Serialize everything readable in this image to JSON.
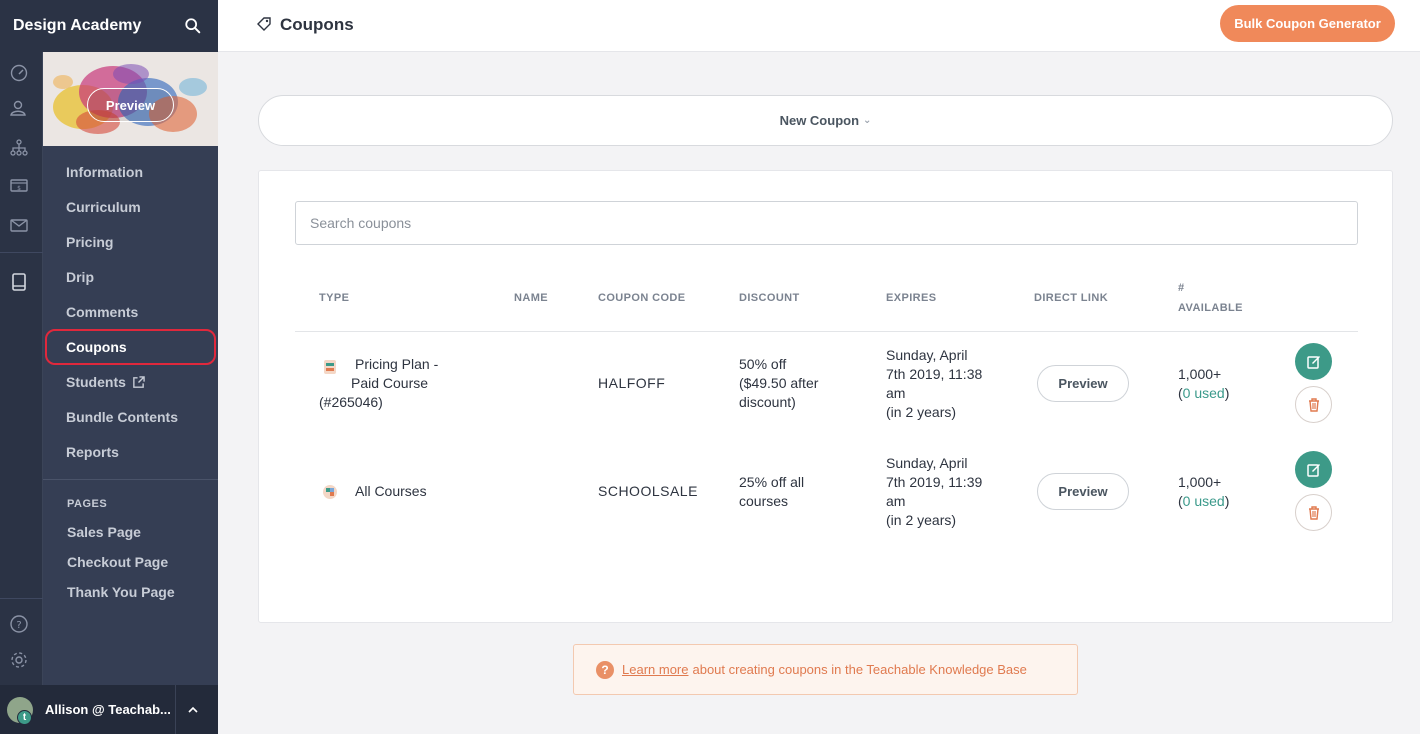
{
  "app": {
    "brand": "Design Academy",
    "page_title": "Coupons",
    "bulk_button": "Bulk Coupon Generator"
  },
  "thumbnail": {
    "preview_label": "Preview"
  },
  "subnav": {
    "items": [
      {
        "label": "Information"
      },
      {
        "label": "Curriculum"
      },
      {
        "label": "Pricing"
      },
      {
        "label": "Drip"
      },
      {
        "label": "Comments"
      },
      {
        "label": "Coupons",
        "active": true
      },
      {
        "label": "Students",
        "external": true
      },
      {
        "label": "Bundle Contents"
      },
      {
        "label": "Reports"
      }
    ],
    "pages_heading": "PAGES",
    "pages": [
      {
        "label": "Sales Page"
      },
      {
        "label": "Checkout Page"
      },
      {
        "label": "Thank You Page"
      }
    ]
  },
  "user": {
    "name": "Allison @ Teachab...",
    "badge": "t"
  },
  "new_coupon": {
    "label": "New Coupon"
  },
  "search": {
    "placeholder": "Search coupons",
    "value": ""
  },
  "table": {
    "headers": {
      "type": "TYPE",
      "name": "NAME",
      "code": "COUPON CODE",
      "discount": "DISCOUNT",
      "expires": "EXPIRES",
      "link": "DIRECT LINK",
      "available_1": "#",
      "available_2": "AVAILABLE"
    },
    "rows": [
      {
        "type_line1": "Pricing Plan -",
        "type_line2": "Paid Course",
        "type_line3": "(#265046)",
        "name": "",
        "code": "HALFOFF",
        "discount_line1": "50% off",
        "discount_line2": "($49.50 after",
        "discount_line3": "discount)",
        "expires_line1": "Sunday, April",
        "expires_line2": "7th 2019, 11:38",
        "expires_line3": "am",
        "expires_line4": "(in 2 years)",
        "link_label": "Preview",
        "available": "1,000+",
        "used": "0 used"
      },
      {
        "type_line1": "All Courses",
        "name": "",
        "code": "SCHOOLSALE",
        "discount_line1": "25% off all",
        "discount_line2": "courses",
        "expires_line1": "Sunday, April",
        "expires_line2": "7th 2019, 11:39",
        "expires_line3": "am",
        "expires_line4": "(in 2 years)",
        "link_label": "Preview",
        "available": "1,000+",
        "used": "0 used"
      }
    ]
  },
  "help_note": {
    "link_text": "Learn more",
    "text": "about creating coupons in the Teachable Knowledge Base"
  },
  "colors": {
    "sidebar": "#2b3345",
    "subnav": "#353e54",
    "accent_orange": "#f0895a",
    "accent_teal": "#3d9a88",
    "active_ring": "#e0283c"
  },
  "icons": {
    "rail": [
      "dashboard-icon",
      "users-icon",
      "sitemap-icon",
      "sales-icon",
      "email-icon",
      "courses-icon",
      "help-icon",
      "settings-icon"
    ],
    "header": "tag-icon",
    "search": "search-icon"
  }
}
